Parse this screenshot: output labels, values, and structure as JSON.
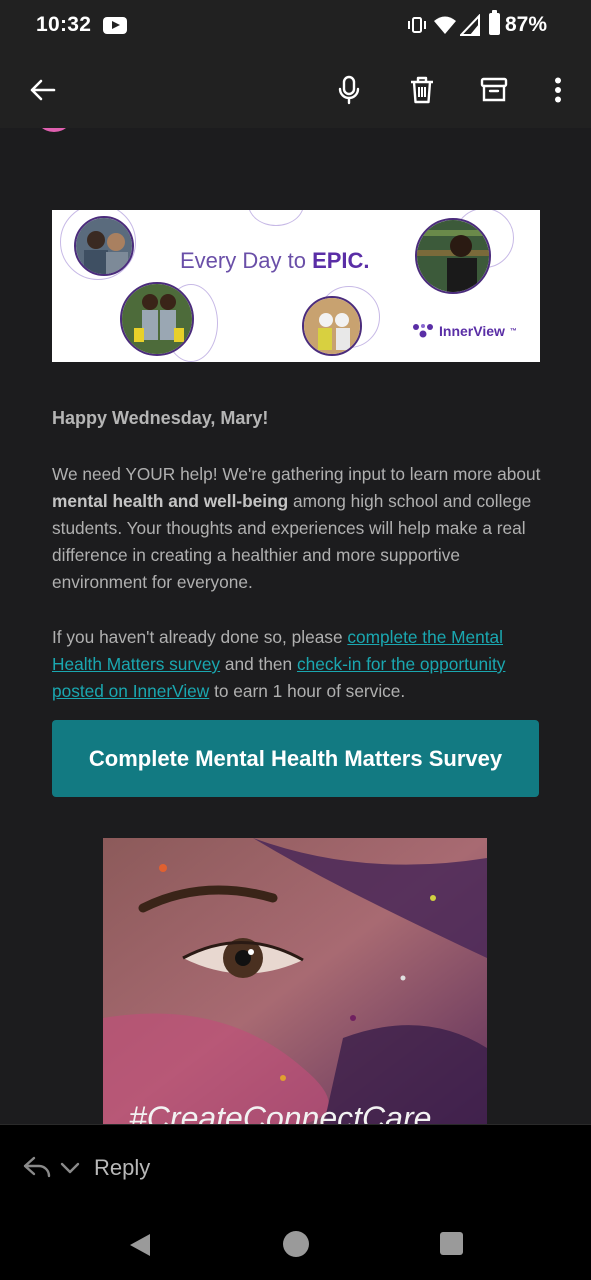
{
  "status_bar": {
    "time": "10:32",
    "battery": "87%",
    "icons": [
      "youtube-icon",
      "vibrate-icon",
      "wifi-icon",
      "signal-icon",
      "battery-icon"
    ]
  },
  "toolbar": {
    "icons": [
      "back-arrow-icon",
      "microphone-icon",
      "delete-icon",
      "archive-icon",
      "more-vert-icon"
    ]
  },
  "email": {
    "banner": {
      "tagline_prefix": "Every Day to",
      "tagline_emphasis": "EPIC.",
      "brand": "InnerView",
      "trademark": "™"
    },
    "greeting": "Happy Wednesday, Mary!",
    "para1": {
      "before": "We need YOUR help! We're gathering input to learn more about",
      "bold": "mental health and well-being",
      "after": "among high school and college students. Your thoughts and experiences will help make a real difference in creating a healthier and more supportive environment for everyone."
    },
    "para2": {
      "before": "If you haven't already done so, please",
      "link1": "complete the Mental Health Matters survey",
      "middle": "and then",
      "link2": "check-in for the opportunity posted on InnerView",
      "after": "to earn 1 hour of service."
    },
    "cta_label": "Complete Mental Health Matters Survey",
    "hero_caption": "#CreateConnectCare"
  },
  "reply_bar": {
    "label": "Reply"
  },
  "colors": {
    "background": "#1c1c1e",
    "toolbar": "#212121",
    "link": "#1aa7b0",
    "button": "#127a82",
    "brand_purple": "#5a2ea6"
  }
}
